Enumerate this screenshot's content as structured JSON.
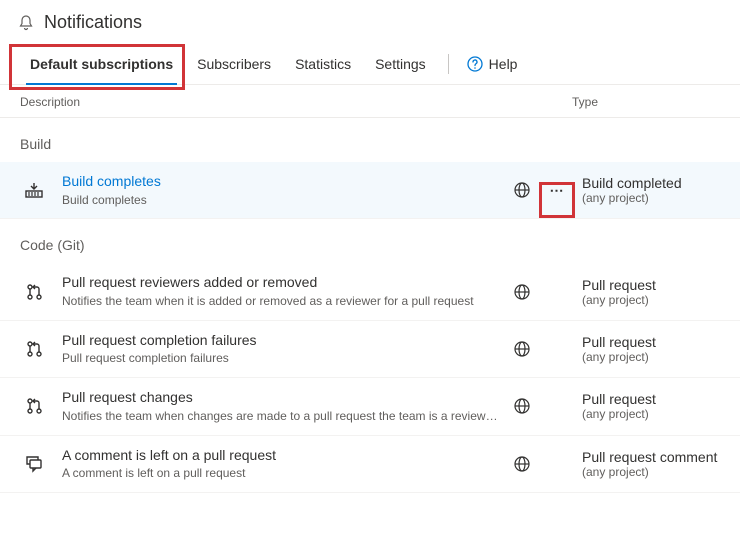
{
  "header": {
    "title": "Notifications"
  },
  "tabs": {
    "items": [
      {
        "label": "Default subscriptions",
        "active": true
      },
      {
        "label": "Subscribers"
      },
      {
        "label": "Statistics"
      },
      {
        "label": "Settings"
      }
    ],
    "help": "Help"
  },
  "columns": {
    "description": "Description",
    "type": "Type"
  },
  "groups": [
    {
      "title": "Build",
      "rows": [
        {
          "icon": "build",
          "title": "Build completes",
          "sub": "Build completes",
          "selected": true,
          "showMore": true,
          "type": "Build completed",
          "scope": "(any project)"
        }
      ]
    },
    {
      "title": "Code (Git)",
      "rows": [
        {
          "icon": "pr",
          "title": "Pull request reviewers added or removed",
          "sub": "Notifies the team when it is added or removed as a reviewer for a pull request",
          "type": "Pull request",
          "scope": "(any project)"
        },
        {
          "icon": "pr",
          "title": "Pull request completion failures",
          "sub": "Pull request completion failures",
          "type": "Pull request",
          "scope": "(any project)"
        },
        {
          "icon": "pr",
          "title": "Pull request changes",
          "sub": "Notifies the team when changes are made to a pull request the team is a reviewer for",
          "type": "Pull request",
          "scope": "(any project)"
        },
        {
          "icon": "comment",
          "title": "A comment is left on a pull request",
          "sub": "A comment is left on a pull request",
          "type": "Pull request comment",
          "scope": "(any project)"
        }
      ]
    }
  ]
}
